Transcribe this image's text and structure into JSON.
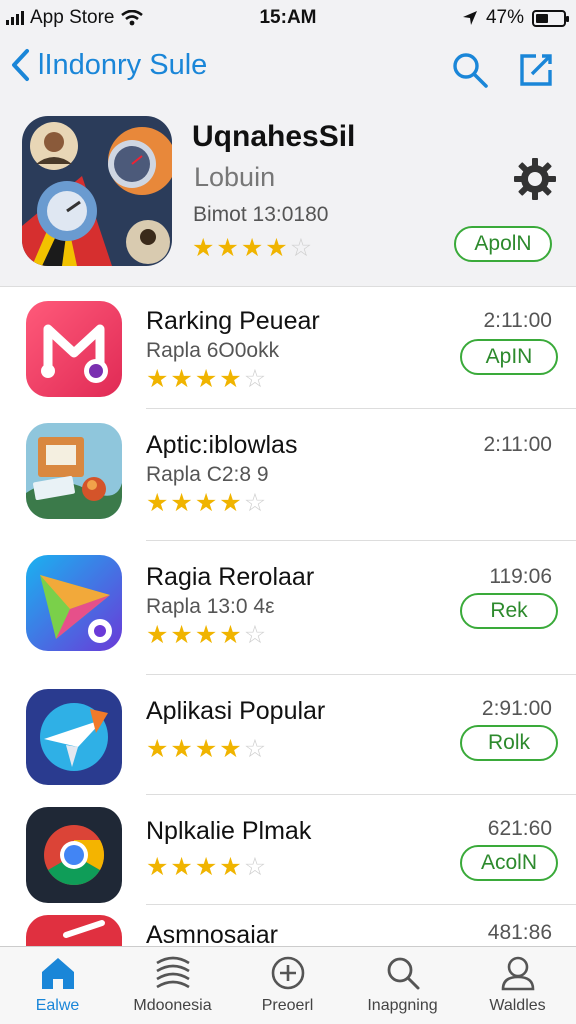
{
  "status_bar": {
    "carrier": "App Store",
    "time": "15:AM",
    "battery": "47%",
    "battery_level": 0.47
  },
  "nav": {
    "title": "lIndonry Sule",
    "icons": [
      "chevron-left-icon",
      "search-icon",
      "compose-icon"
    ]
  },
  "featured": {
    "title": "UqnahesSil",
    "subtitle": "Lobuin",
    "meta": "Bimot 13:0180",
    "rating": 4,
    "button": "ApolN",
    "icon": "gear-icon"
  },
  "apps": [
    {
      "name": "Rarking Peuear",
      "sub": "Rapla 6O0okk",
      "time": "2:11:00",
      "button": "ApIN",
      "rating": 3.5,
      "icon": "mail-app-icon"
    },
    {
      "name": "Aptic:iblowlas",
      "sub": "Rapla C2:8 9",
      "time": "2:11:00",
      "button": "",
      "rating": 3.5,
      "icon": "illustration-app-icon"
    },
    {
      "name": "Ragia Rerolaar",
      "sub": "Rapla 13:0 4ε",
      "time": "119:06",
      "button": "Rek",
      "rating": 4,
      "icon": "paper-plane-app-icon"
    },
    {
      "name": "Aplikasi Popular",
      "sub": "",
      "time": "2:91:00",
      "button": "Rolk",
      "rating": 3.5,
      "icon": "plane-app-icon"
    },
    {
      "name": "Nplkalie Plmak",
      "sub": "",
      "time": "621:60",
      "button": "AcolN",
      "rating": 4,
      "icon": "chrome-icon"
    },
    {
      "name": "Asmnosaiar",
      "sub": "",
      "time": "481:86",
      "button": "",
      "rating": 0,
      "icon": "red-app-icon"
    }
  ],
  "tabs": [
    {
      "label": "Ealwe",
      "icon": "home-icon",
      "active": true
    },
    {
      "label": "Mdoonesia",
      "icon": "waves-icon",
      "active": false
    },
    {
      "label": "Preoerl",
      "icon": "plus-circle-icon",
      "active": false
    },
    {
      "label": "Inapgning",
      "icon": "search-icon",
      "active": false
    },
    {
      "label": "Waldles",
      "icon": "person-icon",
      "active": false
    }
  ],
  "colors": {
    "accent": "#1a86d8",
    "button_green": "#3aaa3a",
    "star": "#f0b400"
  }
}
